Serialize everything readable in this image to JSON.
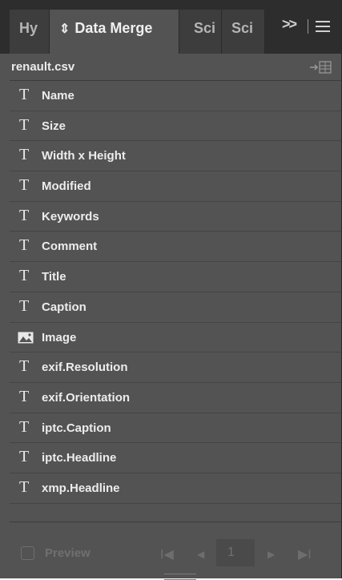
{
  "tabs": [
    {
      "label": "Hy",
      "active": false
    },
    {
      "label": "Data Merge",
      "active": true
    },
    {
      "label": "Sci",
      "active": false
    },
    {
      "label": "Sci",
      "active": false
    }
  ],
  "tab_overflow": ">>",
  "file": {
    "name": "renault.csv"
  },
  "fields": [
    {
      "label": "Name",
      "icon": "text-icon"
    },
    {
      "label": "Size",
      "icon": "text-icon"
    },
    {
      "label": "Width x Height",
      "icon": "text-icon"
    },
    {
      "label": "Modified",
      "icon": "text-icon"
    },
    {
      "label": "Keywords",
      "icon": "text-icon"
    },
    {
      "label": "Comment",
      "icon": "text-icon"
    },
    {
      "label": "Title",
      "icon": "text-icon"
    },
    {
      "label": "Caption",
      "icon": "text-icon"
    },
    {
      "label": "Image",
      "icon": "image-icon"
    },
    {
      "label": "exif.Resolution",
      "icon": "text-icon"
    },
    {
      "label": "exif.Orientation",
      "icon": "text-icon"
    },
    {
      "label": "iptc.Caption",
      "icon": "text-icon"
    },
    {
      "label": "iptc.Headline",
      "icon": "text-icon"
    },
    {
      "label": "xmp.Headline",
      "icon": "text-icon"
    }
  ],
  "footer": {
    "preview_label": "Preview",
    "page_number": "1",
    "first_icon": "I◀",
    "prev_icon": "◀",
    "next_icon": "▶",
    "last_icon": "▶I"
  },
  "colors": {
    "panel": "#535353",
    "tabbar": "#2d2d2d",
    "text": "#ececec"
  }
}
